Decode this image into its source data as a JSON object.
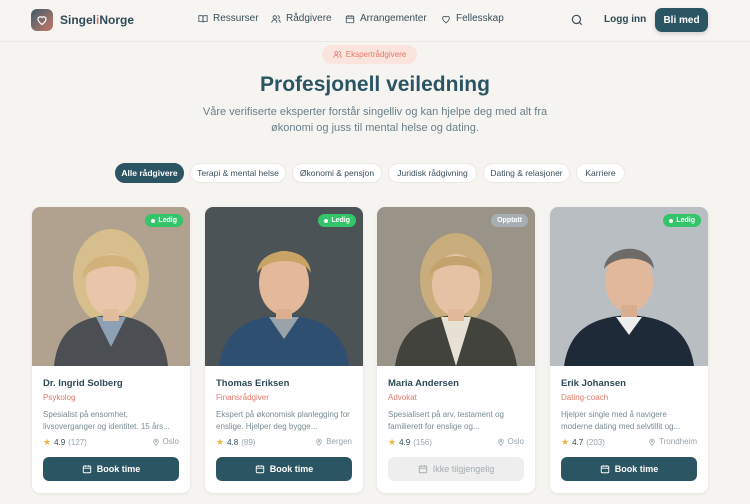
{
  "header": {
    "brand_part1": "Singel",
    "brand_part2": "i",
    "brand_part3": "Norge",
    "nav": [
      {
        "label": "Ressurser",
        "icon": "book-icon"
      },
      {
        "label": "Rådgivere",
        "icon": "users-icon"
      },
      {
        "label": "Arrangementer",
        "icon": "calendar-icon"
      },
      {
        "label": "Fellesskap",
        "icon": "heart-icon"
      }
    ],
    "login_label": "Logg inn",
    "join_label": "Bli med"
  },
  "hero": {
    "badge": "Ekspertrådgivere",
    "title": "Profesjonell veiledning",
    "subtitle": "Våre verifiserte eksperter forstår singelliv og kan hjelpe deg med alt fra økonomi og juss til mental helse og dating."
  },
  "filters": [
    "Alle rådgivere",
    "Terapi & mental helse",
    "Økonomi & pensjon",
    "Juridisk rådgivning",
    "Dating & relasjoner",
    "Karriere"
  ],
  "advisors": [
    {
      "name": "Dr. Ingrid Solberg",
      "role": "Psykolog",
      "description": "Spesialist på ensomhet, livsoverganger og identitet. 15 års...",
      "rating": "4.9",
      "reviews": "(127)",
      "location": "Oslo",
      "status": "Ledig",
      "button": "Book time"
    },
    {
      "name": "Thomas Eriksen",
      "role": "Finansrådgiver",
      "description": "Ekspert på økonomisk planlegging for enslige. Hjelper deg bygge...",
      "rating": "4.8",
      "reviews": "(89)",
      "location": "Bergen",
      "status": "Ledig",
      "button": "Book time"
    },
    {
      "name": "Maria Andersen",
      "role": "Advokat",
      "description": "Spesialisert på arv, testament og familierett for enslige og...",
      "rating": "4.9",
      "reviews": "(156)",
      "location": "Oslo",
      "status": "Opptatt",
      "button": "Ikke tilgjengelig"
    },
    {
      "name": "Erik Johansen",
      "role": "Dating-coach",
      "description": "Hjelper single med å navigere moderne dating med selvtillit og...",
      "rating": "4.7",
      "reviews": "(203)",
      "location": "Trondheim",
      "status": "Ledig",
      "button": "Book time"
    }
  ],
  "colors": {
    "primary": "#2c5563",
    "accent": "#e07a6a",
    "available": "#34c46a",
    "busy": "#a7aeb3",
    "background": "#f6f4f1"
  }
}
